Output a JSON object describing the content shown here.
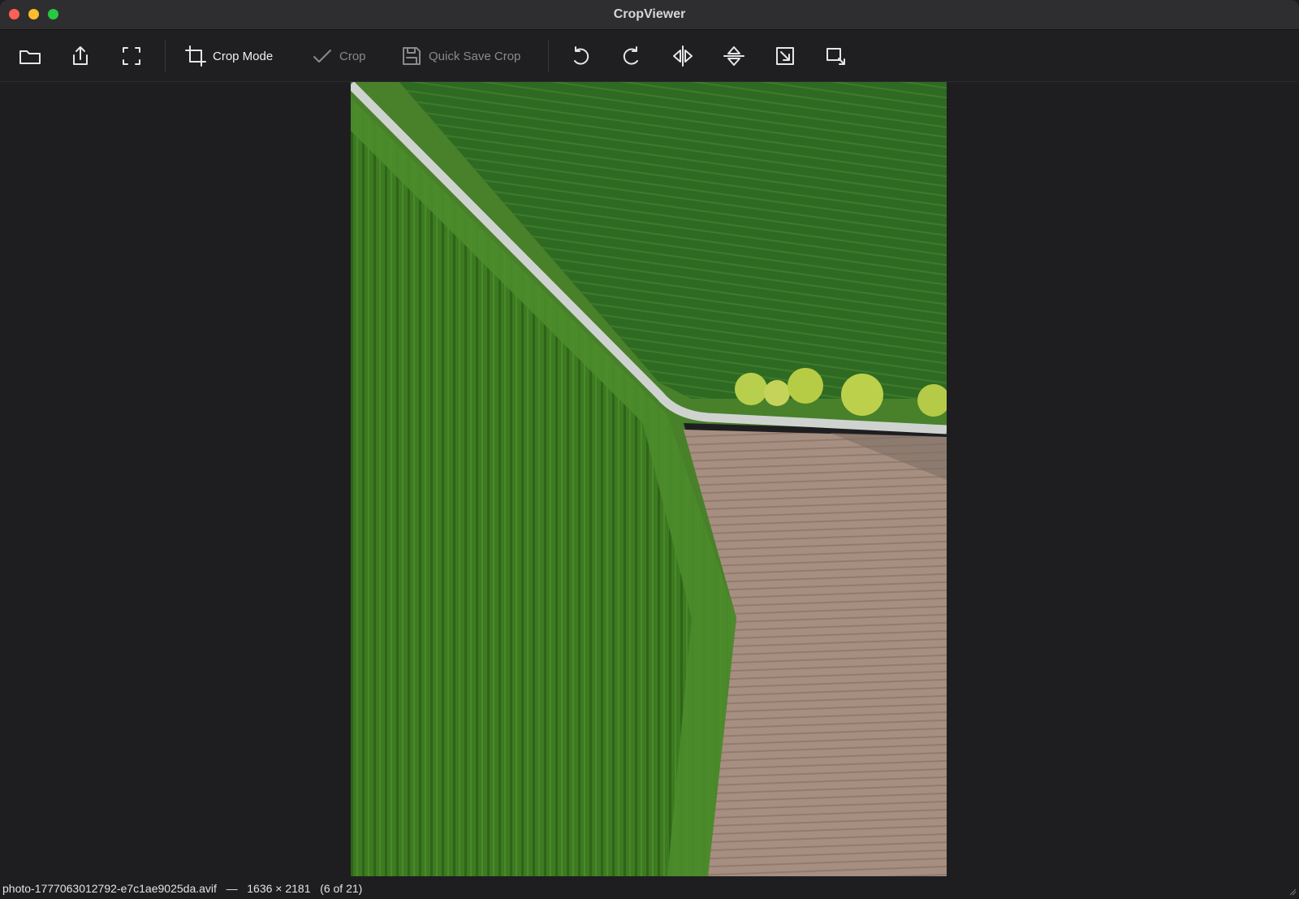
{
  "window": {
    "title": "CropViewer"
  },
  "toolbar": {
    "crop_mode_label": "Crop Mode",
    "crop_label": "Crop",
    "quick_save_label": "Quick Save Crop"
  },
  "status": {
    "filename": "photo-1777063012792-e7c1ae9025da.avif",
    "separator": "—",
    "dimensions": "1636 × 2181",
    "position": "(6 of 21)"
  },
  "image": {
    "description_colors": {
      "grass": "#3f7a22",
      "field": "#a89080",
      "road": "#cfd3d0"
    }
  },
  "icons": [
    "folder-icon",
    "export-icon",
    "fullscreen-icon",
    "crop-icon",
    "checkmark-icon",
    "save-icon",
    "rotate-left-icon",
    "rotate-right-icon",
    "flip-horizontal-icon",
    "flip-vertical-icon",
    "fit-icon",
    "resize-icon"
  ]
}
